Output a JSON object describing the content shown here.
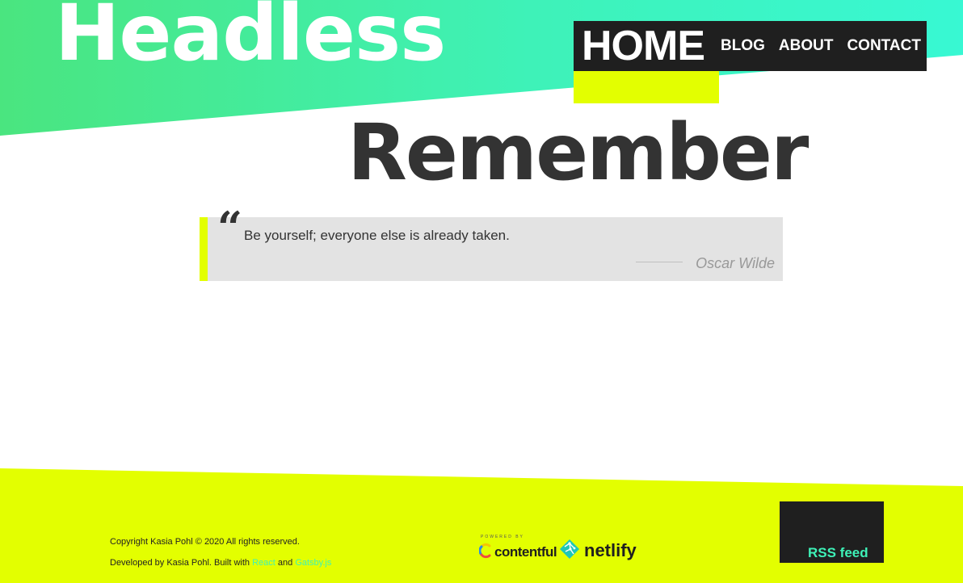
{
  "site": {
    "title": "Headless"
  },
  "nav": {
    "items": [
      {
        "label": "HOME"
      },
      {
        "label": "BLOG"
      },
      {
        "label": "ABOUT"
      },
      {
        "label": "CONTACT"
      }
    ],
    "active": "HOME"
  },
  "page": {
    "title": "Remember"
  },
  "quote": {
    "mark": "“",
    "text": "Be yourself; everyone else is already taken.",
    "author": "Oscar Wilde"
  },
  "footer": {
    "copyright": "Copyright Kasia Pohl © 2020 All rights reserved.",
    "developed_prefix": "Developed by Kasia Pohl. Built with ",
    "react_link": "React",
    "and_text": " and ",
    "gatsby_link": "Gatsby.js",
    "powered_by": "POWERED BY",
    "contentful": "contentful",
    "netlify": "netlify",
    "rss": "RSS feed"
  },
  "colors": {
    "accent_yellow": "#e3ff00",
    "accent_green": "#3ef2b8",
    "dark": "#1f1f1f",
    "text": "#333333"
  },
  "icons": [
    "contentful-icon",
    "netlify-icon"
  ]
}
